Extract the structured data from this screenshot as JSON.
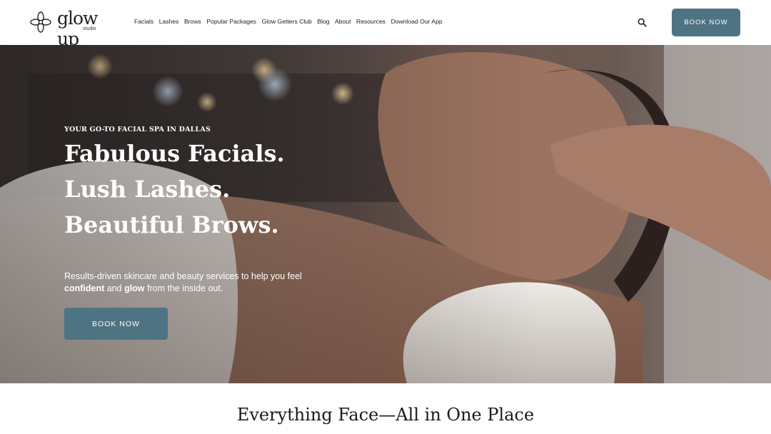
{
  "brand": {
    "logo_word": "glow up",
    "logo_sub": "studio",
    "logo_icon": "flower-logo-icon"
  },
  "nav": {
    "items": [
      {
        "label": "Facials"
      },
      {
        "label": "Lashes"
      },
      {
        "label": "Brows"
      },
      {
        "label": "Popular Packages"
      },
      {
        "label": "Glow Getters Club"
      },
      {
        "label": "Blog"
      },
      {
        "label": "About"
      },
      {
        "label": "Resources"
      },
      {
        "label": "Download Our App"
      }
    ],
    "search_icon": "search-icon",
    "book_label": "BOOK NOW"
  },
  "hero": {
    "eyebrow": "YOUR GO-TO FACIAL SPA IN DALLAS",
    "headline_1": "Fabulous Facials.",
    "headline_2": "Lush Lashes.",
    "headline_3": "Beautiful Brows.",
    "sub_line1": "Results-driven skincare and beauty services to help you feel",
    "sub_bold_1": "confident",
    "sub_mid": " and ",
    "sub_bold_2": "glow",
    "sub_end": " from the inside out.",
    "book_label": "BOOK NOW"
  },
  "section": {
    "title": "Everything Face—All in One Place"
  },
  "colors": {
    "accent": "#4e7483",
    "text": "#222222",
    "background": "#ffffff"
  }
}
